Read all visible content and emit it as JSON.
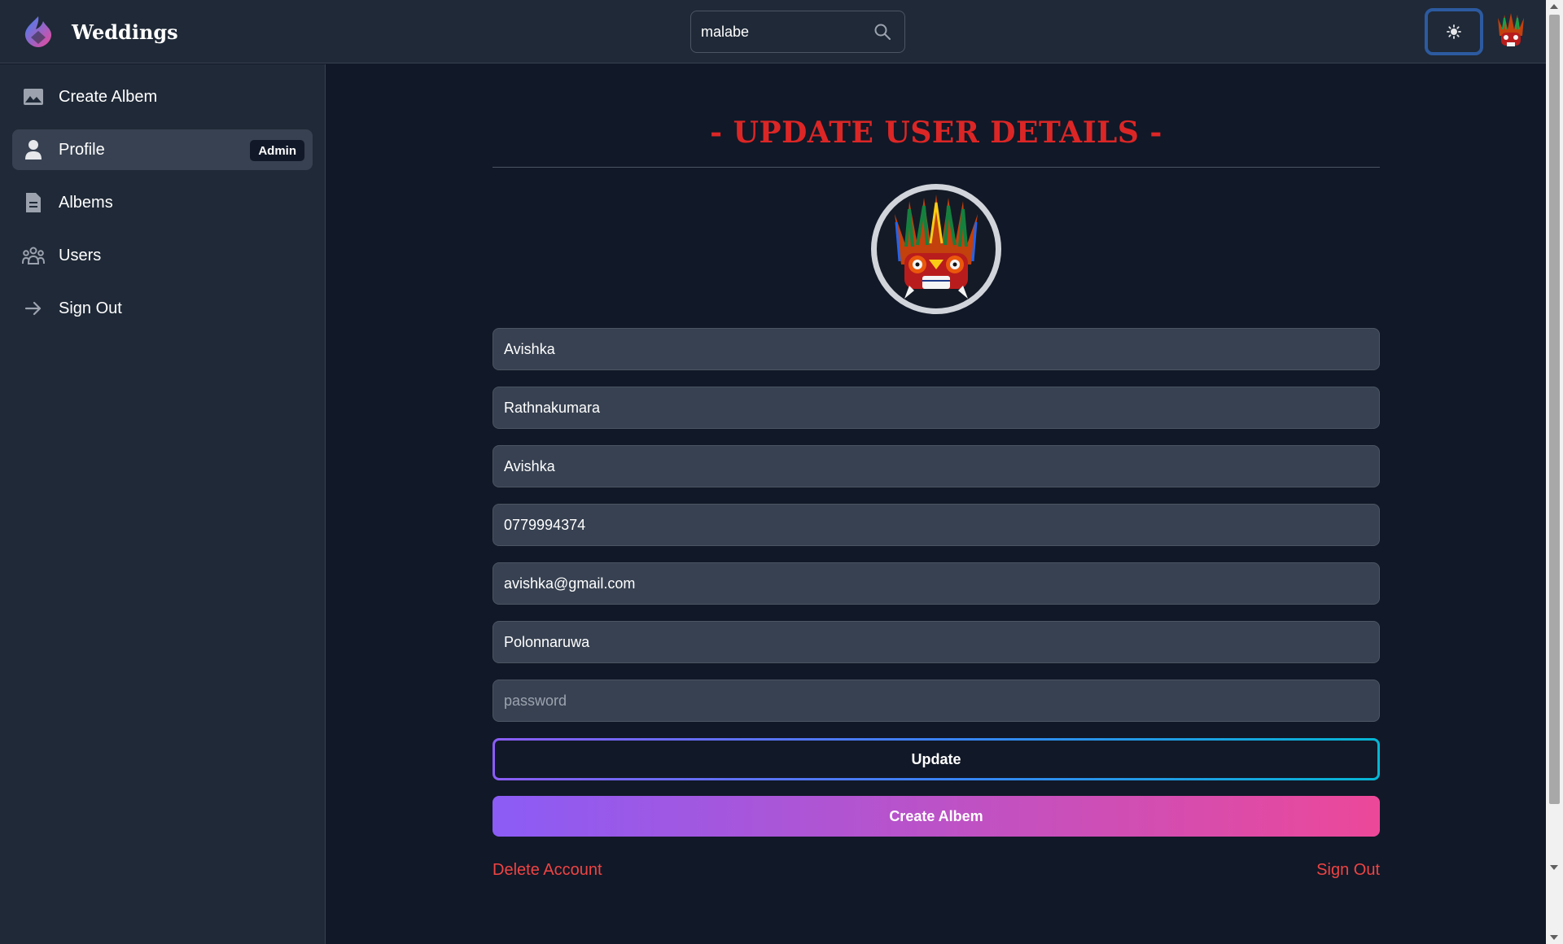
{
  "header": {
    "brand": "Weddings",
    "search_value": "malabe"
  },
  "sidebar": {
    "items": [
      {
        "label": "Create Albem",
        "icon": "image-icon"
      },
      {
        "label": "Profile",
        "icon": "user-icon",
        "badge": "Admin"
      },
      {
        "label": "Albems",
        "icon": "document-icon"
      },
      {
        "label": "Users",
        "icon": "users-icon"
      },
      {
        "label": "Sign Out",
        "icon": "arrow-right-icon"
      }
    ]
  },
  "main": {
    "title": "- UPDATE USER DETAILS -",
    "fields": {
      "first_name": "Avishka",
      "last_name": "Rathnakumara",
      "username": "Avishka",
      "phone": "0779994374",
      "email": "avishka@gmail.com",
      "address": "Polonnaruwa",
      "password_placeholder": "password"
    },
    "update_label": "Update",
    "create_label": "Create Albem",
    "delete_label": "Delete Account",
    "signout_label": "Sign Out"
  },
  "colors": {
    "background": "#111827",
    "panel": "#1f2937",
    "title_red": "#dc2626",
    "link_red": "#ef4444",
    "gradient_start": "#8b5cf6",
    "gradient_end": "#ec4899"
  }
}
